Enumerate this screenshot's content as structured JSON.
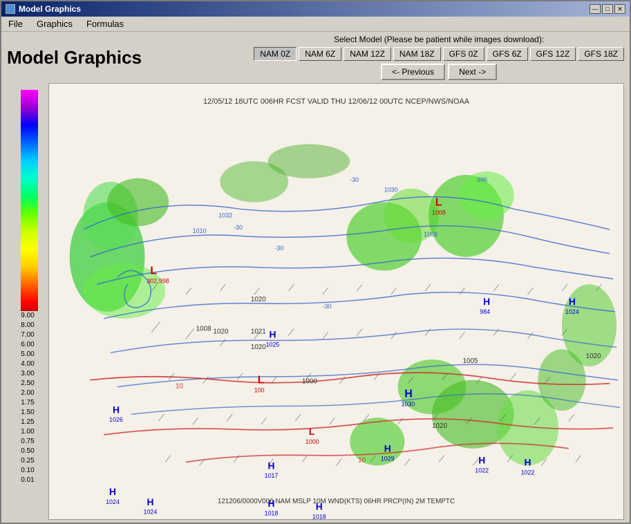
{
  "window": {
    "title": "Model Graphics",
    "icon": "chart-icon"
  },
  "title_bar_buttons": {
    "minimize": "—",
    "maximize": "□",
    "close": "✕"
  },
  "menu": {
    "items": [
      "File",
      "Graphics",
      "Formulas"
    ]
  },
  "page": {
    "title": "Model Graphics"
  },
  "select_model": {
    "label": "Select Model (Please be patient while images download):"
  },
  "model_buttons": {
    "row1": [
      "NAM 0Z",
      "NAM 6Z",
      "NAM 12Z",
      "NAM 18Z"
    ],
    "row2": [
      "GFS 0Z",
      "GFS 6Z",
      "GFS 12Z",
      "GFS 18Z"
    ]
  },
  "nav_buttons": {
    "previous": "<- Previous",
    "next": "Next ->"
  },
  "map": {
    "title_line": "12/05/12 18UTC  006HR FCST VALID THU 12/06/12 00UTC  NCEP/NWS/NOAA",
    "bottom_label": "121206/0000V006 NAM MSLP 10M WND(KTS) 06HR PRCP(IN) 2M TEMPTC"
  },
  "legend": {
    "values": [
      "9.00",
      "8.00",
      "7.00",
      "6.00",
      "5.00",
      "4.00",
      "3.00",
      "2.50",
      "2.00",
      "1.75",
      "1.50",
      "1.25",
      "1.00",
      "0.75",
      "0.50",
      "0.25",
      "0.10",
      "0.01"
    ]
  }
}
